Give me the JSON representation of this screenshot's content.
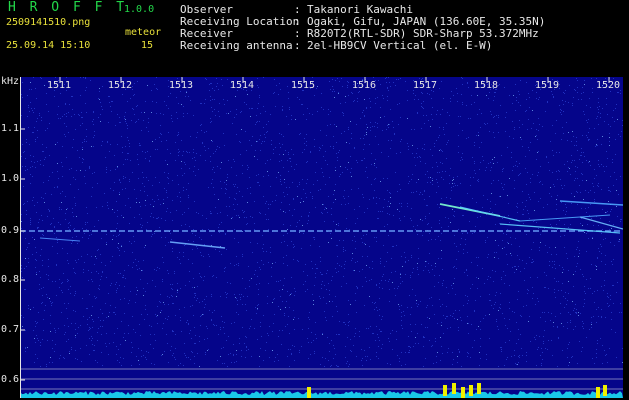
{
  "header": {
    "app_name": "H R O F F T",
    "version": "1.0.0",
    "file_name": "2509141510.png",
    "detect_label": "meteor",
    "timestamp": "25.09.14 15:10",
    "meteor_count": "15"
  },
  "station": [
    {
      "key": "Observer",
      "sep": ":",
      "value": "Takanori Kawachi"
    },
    {
      "key": "Receiving Location",
      "sep": ":",
      "value": "Ogaki, Gifu, JAPAN (136.60E, 35.35N)"
    },
    {
      "key": "Receiver",
      "sep": ":",
      "value": "R820T2(RTL-SDR) SDR-Sharp 53.372MHz"
    },
    {
      "key": "Receiving antenna",
      "sep": ":",
      "value": "2el-HB9CV Vertical (el. E-W)"
    }
  ],
  "chart_data": {
    "type": "heatmap",
    "ylabel": "kHz",
    "y_ticks": [
      "1.1",
      "1.0",
      "0.9",
      "0.8",
      "0.7",
      "0.6"
    ],
    "x_ticks": [
      "1511",
      "1512",
      "1513",
      "1514",
      "1515",
      "1516",
      "1517",
      "1518",
      "1519",
      "1520"
    ],
    "colors": {
      "background": "#05058a",
      "noise": "#2a3fd0",
      "signal": "#7fffd0",
      "grid": "#e8e8e8",
      "power_trace": "#19c8e8",
      "power_peak": "#f0f000"
    }
  }
}
